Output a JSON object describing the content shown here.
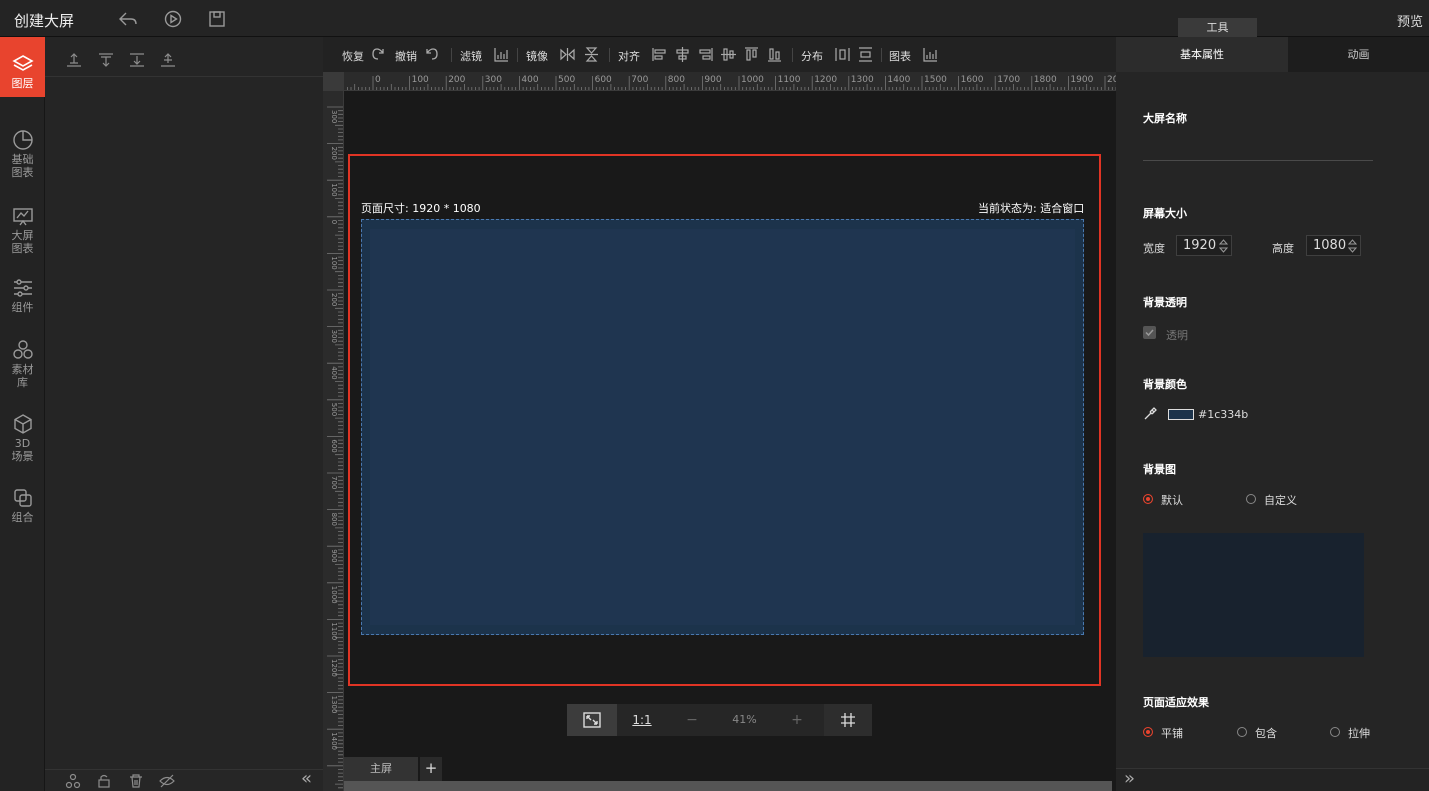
{
  "app": {
    "title": "创建大屏",
    "preview": "预览",
    "tools_tab": "工具"
  },
  "topbar_icons": [
    "undo-arrow-icon",
    "play-icon",
    "save-icon"
  ],
  "leftnav": [
    {
      "label": "图层",
      "icon": "layers-icon",
      "active": true
    },
    {
      "label": "基础\n图表",
      "icon": "pie-chart-icon"
    },
    {
      "label": "大屏\n图表",
      "icon": "screen-chart-icon"
    },
    {
      "label": "组件",
      "icon": "sliders-icon"
    },
    {
      "label": "素材\n库",
      "icon": "material-icon"
    },
    {
      "label": "3D\n场景",
      "icon": "cube-icon"
    },
    {
      "label": "组合",
      "icon": "combine-icon"
    }
  ],
  "toolbar": {
    "redo": "恢复",
    "undo": "撤销",
    "filter": "滤镜",
    "mirror": "镜像",
    "align": "对齐",
    "distribute": "分布",
    "chart": "图表"
  },
  "ruler": {
    "h_ticks": [
      "0",
      "100",
      "200",
      "300",
      "400",
      "500",
      "600",
      "700",
      "800",
      "900",
      "1000",
      "1100",
      "1200",
      "1300",
      "1400",
      "1500",
      "1600",
      "1700",
      "1800",
      "1900",
      "20"
    ],
    "v_ticks": [
      "300",
      "200",
      "100",
      "0",
      "100",
      "200",
      "300",
      "400",
      "500",
      "600",
      "700",
      "800",
      "900",
      "1000",
      "1100",
      "1200",
      "1300",
      "1400"
    ]
  },
  "canvas": {
    "page_size": "页面尺寸: 1920 * 1080",
    "status": "当前状态为: 适合窗口",
    "bg_color": "#1c334b"
  },
  "zoom": {
    "one_to_one": "1:1",
    "minus": "−",
    "level": "41%",
    "plus": "+"
  },
  "tabs": {
    "main": "主屏",
    "add": "+"
  },
  "props": {
    "tab_basic": "基本属性",
    "tab_anim": "动画",
    "name_label": "大屏名称",
    "name_value": "",
    "size_label": "屏幕大小",
    "width_label": "宽度",
    "width_value": "1920",
    "height_label": "高度",
    "height_value": "1080",
    "transparent_label": "背景透明",
    "transparent_option": "透明",
    "bgcolor_label": "背景颜色",
    "bgcolor_value": "#1c334b",
    "bgimage_label": "背景图",
    "bgimage_default": "默认",
    "bgimage_custom": "自定义",
    "fit_label": "页面适应效果",
    "fit_tile": "平铺",
    "fit_contain": "包含",
    "fit_stretch": "拉伸"
  }
}
